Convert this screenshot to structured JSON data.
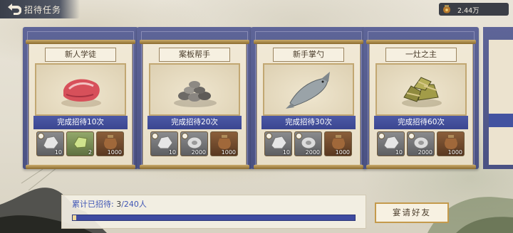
{
  "header": {
    "title": "招待任务",
    "back_icon": "back-arrow-icon",
    "currency": {
      "icon": "coin-jar-icon",
      "value": "2.44万"
    }
  },
  "cards": [
    {
      "title": "新人学徒",
      "task": "完成招待10次",
      "dish_icon": "raw-meat-icon",
      "rewards": [
        {
          "icon": "ore-icon",
          "count": "10",
          "color": "gray"
        },
        {
          "icon": "jade-icon",
          "count": "2",
          "color": "green"
        },
        {
          "icon": "wine-jar-icon",
          "count": "1000",
          "color": "brown"
        }
      ]
    },
    {
      "title": "案板帮手",
      "task": "完成招待20次",
      "dish_icon": "shellfish-pile-icon",
      "rewards": [
        {
          "icon": "ore-icon",
          "count": "10",
          "color": "gray"
        },
        {
          "icon": "silver-coin-icon",
          "count": "2000",
          "color": "gray"
        },
        {
          "icon": "wine-jar-icon",
          "count": "1000",
          "color": "brown"
        }
      ]
    },
    {
      "title": "新手掌勺",
      "task": "完成招待30次",
      "dish_icon": "fish-icon",
      "rewards": [
        {
          "icon": "ore-icon",
          "count": "10",
          "color": "gray"
        },
        {
          "icon": "silver-coin-icon",
          "count": "2000",
          "color": "gray"
        },
        {
          "icon": "wine-jar-icon",
          "count": "1000",
          "color": "brown"
        }
      ]
    },
    {
      "title": "一灶之主",
      "task": "完成招待60次",
      "dish_icon": "zongzi-icon",
      "rewards": [
        {
          "icon": "ore-icon",
          "count": "10",
          "color": "gray"
        },
        {
          "icon": "silver-coin-icon",
          "count": "2000",
          "color": "gray"
        },
        {
          "icon": "wine-jar-icon",
          "count": "1000",
          "color": "brown"
        }
      ]
    }
  ],
  "progress": {
    "label": "累计已招待:",
    "count": "3",
    "total": "/240人",
    "fraction": 0.0125
  },
  "invite_button": "宴请好友",
  "colors": {
    "accent_blue": "#3f55b5",
    "gold": "#c49a4c"
  }
}
